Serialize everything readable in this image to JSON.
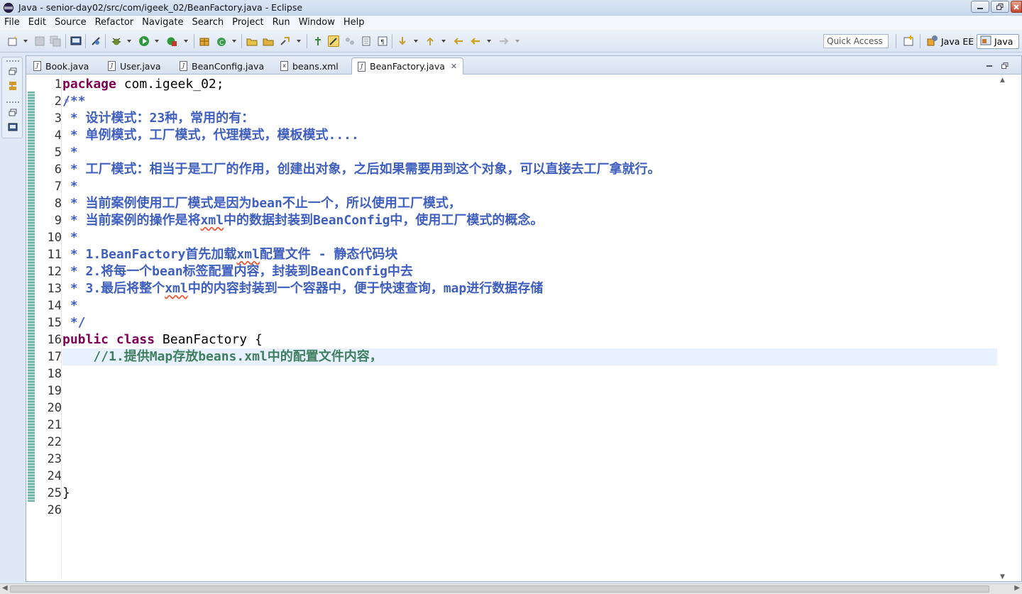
{
  "window": {
    "title": "Java - senior-day02/src/com/igeek_02/BeanFactory.java - Eclipse"
  },
  "menu": [
    "File",
    "Edit",
    "Source",
    "Refactor",
    "Navigate",
    "Search",
    "Project",
    "Run",
    "Window",
    "Help"
  ],
  "toolbar": {
    "quick_access_placeholder": "Quick Access",
    "perspectives": [
      {
        "label": "Java EE",
        "icon": "java-ee-perspective-icon"
      },
      {
        "label": "Java",
        "icon": "java-perspective-icon",
        "active": true
      }
    ]
  },
  "tabs": [
    {
      "label": "Book.java",
      "icon": "java-file-icon"
    },
    {
      "label": "User.java",
      "icon": "java-file-icon"
    },
    {
      "label": "BeanConfig.java",
      "icon": "java-file-icon"
    },
    {
      "label": "beans.xml",
      "icon": "xml-file-icon"
    },
    {
      "label": "BeanFactory.java",
      "icon": "java-file-icon",
      "active": true
    }
  ],
  "editor": {
    "line_numbers": [
      "1",
      "2",
      "3",
      "4",
      "5",
      "6",
      "7",
      "8",
      "9",
      "10",
      "11",
      "12",
      "13",
      "14",
      "15",
      "16",
      "17",
      "18",
      "19",
      "20",
      "21",
      "22",
      "23",
      "24",
      "25",
      "26"
    ],
    "current_line": 17,
    "code": {
      "l1_kw": "package",
      "l1_rest": " com.igeek_02;",
      "l2": "/**",
      "l3": " * 设计模式：23种，常用的有：",
      "l4": " * 单例模式，工厂模式，代理模式，模板模式....",
      "l5": " *",
      "l6": " * 工厂模式：相当于是工厂的作用，创建出对象，之后如果需要用到这个对象，可以直接去工厂拿就行。",
      "l7": " *",
      "l8": " * 当前案例使用工厂模式是因为bean不止一个，所以使用工厂模式，",
      "l9_a": " * 当前案例的操作是将",
      "l9_b": "xml",
      "l9_c": "中的数据封装到BeanConfig中，使用工厂模式的概念。",
      "l10": " *",
      "l11_a": " * 1.BeanFactory首先加载",
      "l11_b": "xml",
      "l11_c": "配置文件 - 静态代码块",
      "l12": " * 2.将每一个bean标签配置内容，封装到BeanConfig中去",
      "l13_a": " * 3.最后将整个",
      "l13_b": "xml",
      "l13_c": "中的内容封装到一个容器中，便于快速查询，map进行数据存储",
      "l14": " *",
      "l15": " */",
      "l16_kw1": "public",
      "l16_kw2": "class",
      "l16_rest": " BeanFactory {",
      "l17": "    //1.提供Map存放beans.xml中的配置文件内容，",
      "l25": "}"
    }
  }
}
